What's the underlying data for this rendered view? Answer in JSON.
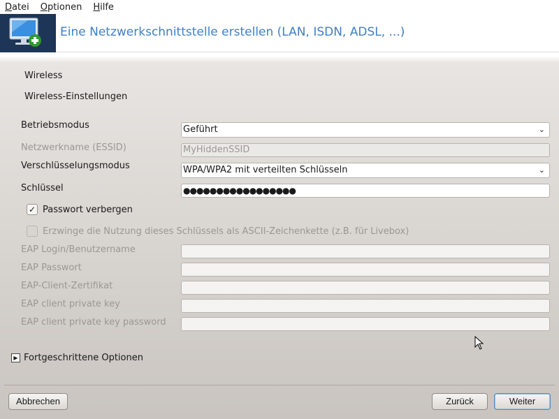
{
  "menubar": {
    "items": [
      {
        "first": "D",
        "rest": "atei"
      },
      {
        "first": "O",
        "rest": "ptionen"
      },
      {
        "first": "H",
        "rest": "ilfe"
      }
    ]
  },
  "banner": {
    "title": "Eine Netzwerkschnittstelle erstellen (LAN, ISDN, ADSL, ...)",
    "icon": "network-monitor-add-icon"
  },
  "sections": {
    "wireless": "Wireless",
    "wireless_settings": "Wireless-Einstellungen"
  },
  "form": {
    "operating_mode": {
      "label": "Betriebsmodus",
      "value": "Geführt"
    },
    "essid": {
      "label": "Netzwerkname (ESSID)",
      "value": "MyHiddenSSID"
    },
    "encryption_mode": {
      "label": "Verschlüsselungsmodus",
      "value": "WPA/WPA2 mit verteilten Schlüsseln"
    },
    "key": {
      "label": "Schlüssel",
      "value": "●●●●●●●●●●●●●●●●●"
    },
    "hide_password": {
      "label": "Passwort verbergen",
      "checked": true
    },
    "force_ascii": {
      "label": "Erzwinge die Nutzung dieses Schlüssels als ASCII-Zeichenkette (z.B. für Livebox)",
      "checked": false
    },
    "eap_login": {
      "label": "EAP Login/Benutzername",
      "value": ""
    },
    "eap_password": {
      "label": "EAP Passwort",
      "value": ""
    },
    "eap_client_cert": {
      "label": "EAP-Client-Zertifikat",
      "value": ""
    },
    "eap_private_key": {
      "label": "EAP client private key",
      "value": ""
    },
    "eap_private_key_password": {
      "label": "EAP client private key password",
      "value": ""
    }
  },
  "advanced": {
    "label": "Fortgeschrittene Optionen"
  },
  "buttons": {
    "cancel": "Abbrechen",
    "back": "Zurück",
    "next": "Weiter"
  },
  "colors": {
    "title_blue": "#3f7fc6",
    "banner_icon_bg": "#1d3556"
  }
}
